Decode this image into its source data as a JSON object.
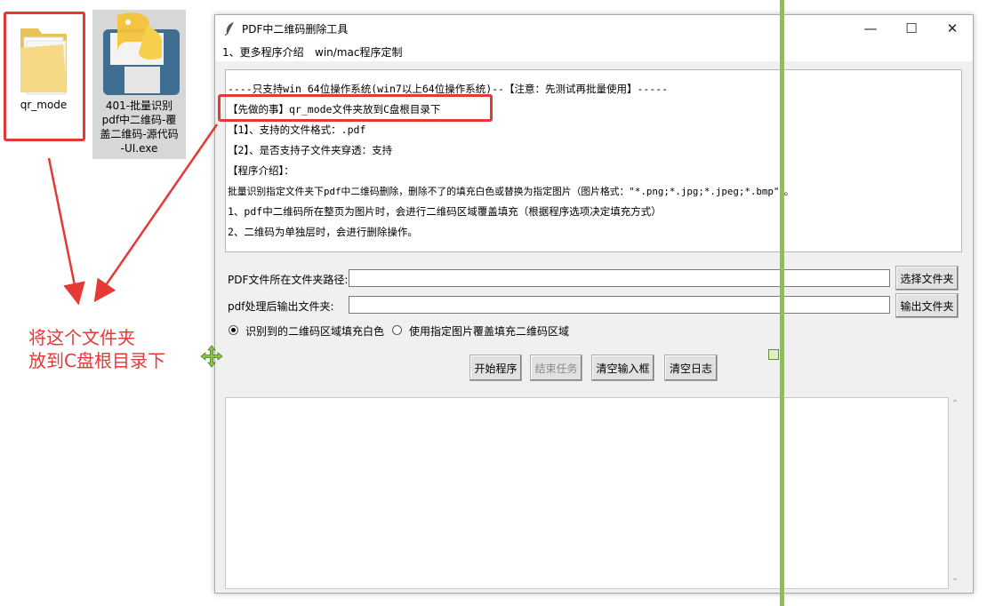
{
  "desktop": {
    "icons": [
      {
        "label": "qr_mode",
        "type": "folder-icon"
      },
      {
        "label": "401-批量识别pdf中二维码-覆盖二维码-源代码-UI.exe",
        "label_lines": [
          "401-批量识别",
          "pdf中二维码-覆",
          "盖二维码-源代码",
          "-UI.exe"
        ],
        "type": "python-app-icon"
      }
    ]
  },
  "annotation": {
    "lines": [
      "将这个文件夹",
      "放到C盘根目录下"
    ],
    "color": "#e53935"
  },
  "window": {
    "title": "PDF中二维码删除工具",
    "menu": [
      "1、更多程序介绍",
      "win/mac程序定制"
    ],
    "controls": {
      "minimize": "—",
      "maximize": "☐",
      "close": "✕"
    },
    "info_lines": [
      "----只支持win 64位操作系统(win7以上64位操作系统)--【注意：先测试再批量使用】-----",
      "【先做的事】qr_mode文件夹放到C盘根目录下",
      "【1】、支持的文件格式：.pdf",
      "【2】、是否支持子文件夹穿透：支持",
      "【程序介绍】：",
      "批量识别指定文件夹下pdf中二维码删除，删除不了的填充白色或替换为指定图片（图片格式：\"*.png;*.jpg;*.jpeg;*.bmp\"）。",
      "1、pdf中二维码所在整页为图片时，会进行二维码区域覆盖填充（根据程序选项决定填充方式）",
      "2、二维码为单独层时，会进行删除操作。"
    ],
    "form": {
      "pdf_path_label": "PDF文件所在文件夹路径:",
      "pdf_path_value": "",
      "select_folder_button": "选择文件夹",
      "output_label": "pdf处理后输出文件夹:",
      "output_value": "",
      "output_button": "输出文件夹",
      "radio_fill_white": "识别到的二维码区域填充白色",
      "radio_fill_white_selected": true,
      "radio_use_image": "使用指定图片覆盖填充二维码区域",
      "radio_use_image_selected": false
    },
    "buttons": {
      "start": "开始程序",
      "stop": "结束任务",
      "clear_input": "清空输入框",
      "clear_log": "清空日志"
    },
    "log": ""
  }
}
